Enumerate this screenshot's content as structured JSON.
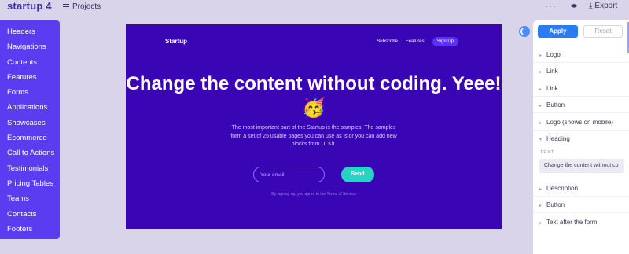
{
  "app": {
    "title": "startup 4"
  },
  "toolbar": {
    "projects_label": "Projects",
    "more_label": "···",
    "code_label": "◂▸",
    "export_label": "Export"
  },
  "sidebar": {
    "items": [
      {
        "label": "Headers"
      },
      {
        "label": "Navigations"
      },
      {
        "label": "Contents"
      },
      {
        "label": "Features"
      },
      {
        "label": "Forms"
      },
      {
        "label": "Applications"
      },
      {
        "label": "Showcases"
      },
      {
        "label": "Ecommerce"
      },
      {
        "label": "Call to Actions"
      },
      {
        "label": "Testimonials"
      },
      {
        "label": "Pricing Tables"
      },
      {
        "label": "Teams"
      },
      {
        "label": "Contacts"
      },
      {
        "label": "Footers"
      }
    ]
  },
  "preview": {
    "brand": "Startup",
    "nav": {
      "subscribe": "Subscribe",
      "features": "Features",
      "signup": "Sign Up"
    },
    "heading": "Change the content without coding. Yeee! 🥳",
    "description": "The most important part of the Startup is the samples. The samples form a set of 25 usable pages you can use as is or you can add new blocks from UI Kit.",
    "email_placeholder": "Your email",
    "send_label": "Send",
    "note": "By signing up, you agree to the Terms of Service"
  },
  "panel": {
    "apply_label": "Apply",
    "reset_label": "Reset",
    "items": [
      {
        "label": "Logo"
      },
      {
        "label": "Link"
      },
      {
        "label": "Link"
      },
      {
        "label": "Button"
      },
      {
        "label": "Logo (shows on mobile)"
      },
      {
        "label": "Heading"
      }
    ],
    "field_label": "TEXT",
    "field_value": "Change the content without co",
    "items_after": [
      {
        "label": "Description"
      },
      {
        "label": "Button"
      },
      {
        "label": "Text after the form"
      }
    ]
  },
  "colors": {
    "sidebar": "#5b3cf0",
    "preview_bg": "#3a05b5",
    "accent": "#2a7cf0",
    "send": "#27d3c4"
  }
}
